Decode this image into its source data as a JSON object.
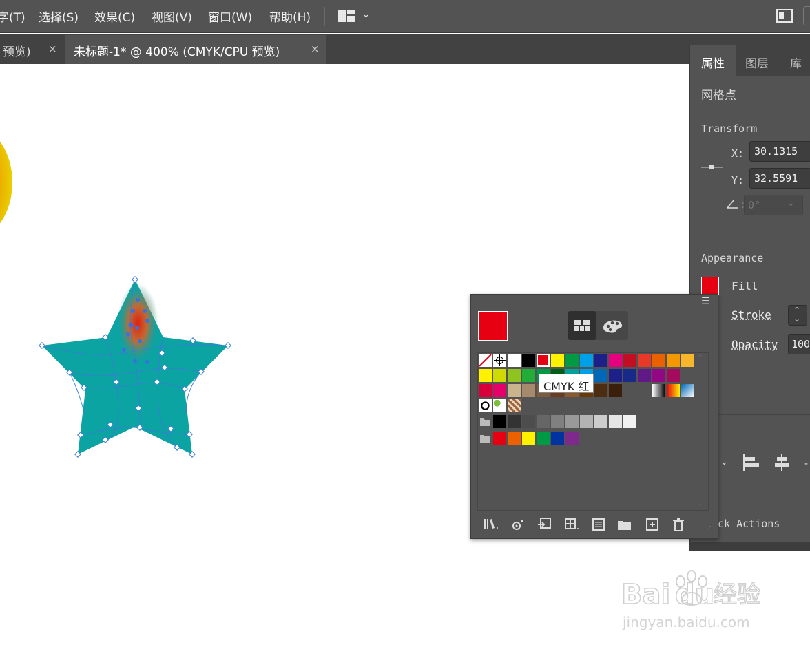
{
  "menu": {
    "items": [
      "字(T)",
      "选择(S)",
      "效果(C)",
      "视图(V)",
      "窗口(W)",
      "帮助(H)"
    ]
  },
  "tabs": [
    {
      "title": "预览)",
      "close": "×"
    },
    {
      "title": "未标题-1* @ 400% (CMYK/CPU 预览)",
      "close": "×"
    }
  ],
  "properties": {
    "tabs": [
      "属性",
      "图层",
      "库"
    ],
    "object_type": "网格点",
    "transform": {
      "title": "Transform",
      "x_label": "X:",
      "x_value": "30.1315",
      "y_label": "Y:",
      "y_value": "32.5591",
      "angle_value": "0°"
    },
    "appearance": {
      "title": "Appearance",
      "fill_label": "Fill",
      "fill_color": "#e60012",
      "stroke_label": "Stroke",
      "opacity_label": "Opacity",
      "opacity_value": "100"
    },
    "align_title": "gn",
    "quick_actions": "ck Actions"
  },
  "swatches": {
    "current_fill": "#e60012",
    "tooltip": "CMYK 红",
    "row1": [
      "#ffffff",
      "#000000",
      "#e60012",
      "#fff100",
      "#009944",
      "#00a0e9",
      "#1d2088",
      "#e4007f",
      "#c30d23",
      "#e83828",
      "#eb6100",
      "#f39800",
      "#f8b62d"
    ],
    "row2": [
      "#fff100",
      "#cfdb00",
      "#8fc31f",
      "#22ac38",
      "#009944",
      "#005e15",
      "#00a29a",
      "#00a0e9",
      "#0068b7",
      "#1d2088",
      "#172a88",
      "#601986",
      "#920783",
      "#a40b5d"
    ],
    "row3": [
      "#d7003a",
      "#e5006a",
      "#c9b48e",
      "#a58a6b",
      "#7d5c3e",
      "#6b3d1e",
      "#8c5a2b",
      "#6a3906",
      "#4d2d10",
      "#3b1f0a"
    ],
    "gray_row": [
      "#000000",
      "#333333",
      "#4d4d4d",
      "#666666",
      "#808080",
      "#999999",
      "#b3b3b3",
      "#cccccc",
      "#e6e6e6",
      "#f2f2f2"
    ],
    "color_group": [
      "#e60012",
      "#eb6100",
      "#fff100",
      "#009944",
      "#0033a0",
      "#7d2a8c"
    ]
  },
  "star_fill_color": "#0ca3a3",
  "watermark": {
    "line1": "Bai",
    "line1b": "du",
    "cn": "经验",
    "line2": "jingyan.baidu.com"
  }
}
